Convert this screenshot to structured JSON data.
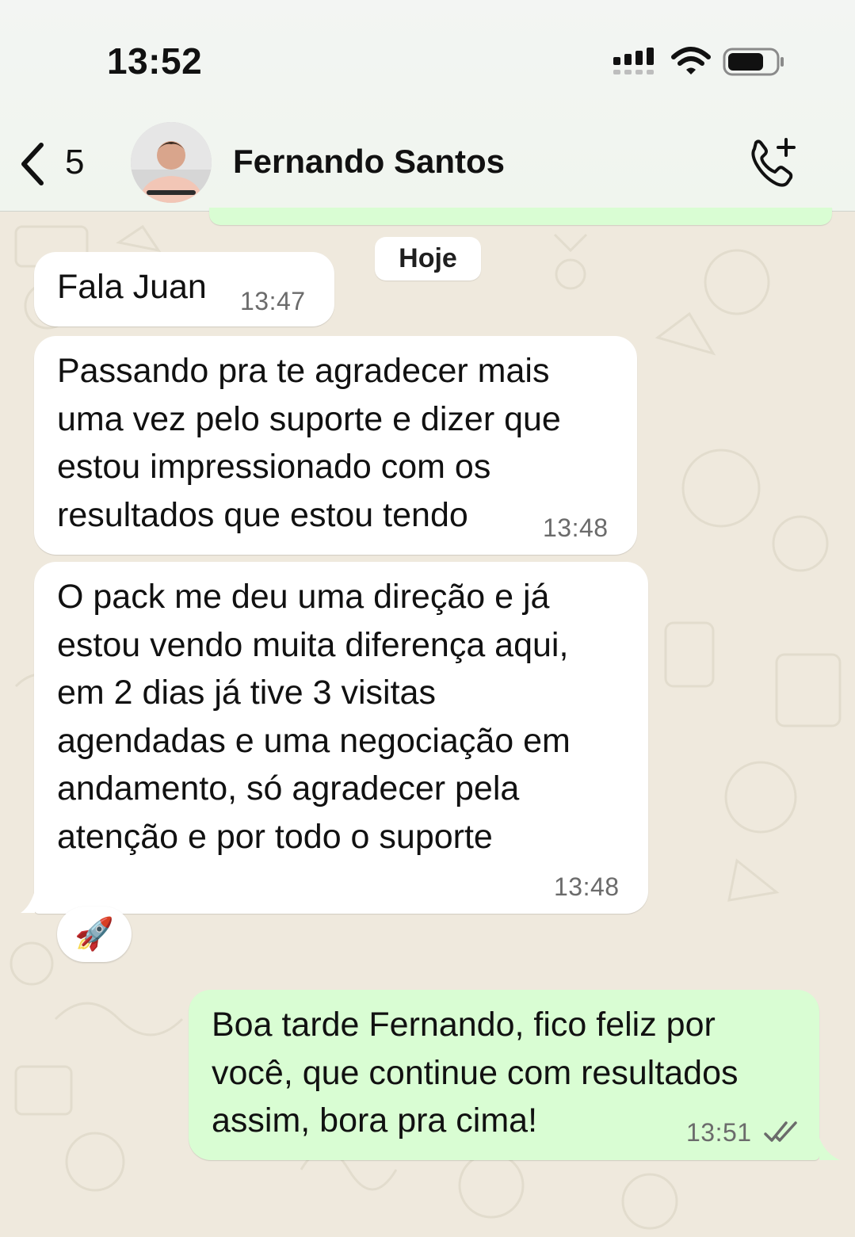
{
  "status_bar": {
    "time": "13:52"
  },
  "header": {
    "back_count": "5",
    "contact_name": "Fernando Santos",
    "icons": [
      "chevron-left-icon",
      "avatar",
      "add-call-icon"
    ]
  },
  "date_separator": "Hoje",
  "messages": [
    {
      "direction": "incoming",
      "text": "Fala Juan",
      "time": "13:47"
    },
    {
      "direction": "incoming",
      "lines": [
        "Passando pra te agradecer mais",
        "uma vez pelo suporte e dizer que",
        "estou impressionado com os",
        "resultados que estou tendo"
      ],
      "time": "13:48"
    },
    {
      "direction": "incoming",
      "lines": [
        "O pack me deu uma direção e já",
        "estou vendo muita diferença aqui,",
        "em 2 dias já tive 3 visitas",
        "agendadas e uma negociação em",
        "andamento, só agradecer pela",
        "atenção e por todo o suporte"
      ],
      "time": "13:48",
      "reaction": "🚀"
    },
    {
      "direction": "outgoing",
      "lines": [
        "Boa tarde Fernando, fico feliz por",
        "você, que continue com resultados",
        "assim, bora pra cima!"
      ],
      "time": "13:51",
      "status": "read"
    }
  ],
  "colors": {
    "incoming_bubble": "#ffffff",
    "outgoing_bubble": "#d9fdd3",
    "wallpaper": "#efe9dd",
    "read_ticks": "#6b6b6b"
  }
}
